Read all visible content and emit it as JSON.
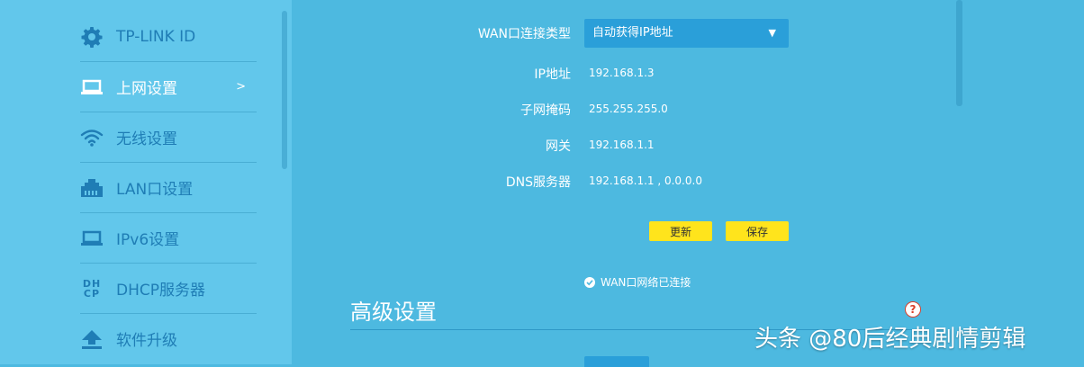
{
  "sidebar": {
    "items": [
      {
        "label": "TP-LINK ID",
        "icon": "gear-icon",
        "active": false
      },
      {
        "label": "上网设置",
        "icon": "laptop-icon",
        "active": true,
        "arrow": ">"
      },
      {
        "label": "无线设置",
        "icon": "wifi-icon",
        "active": false
      },
      {
        "label": "LAN口设置",
        "icon": "ethernet-port-icon",
        "active": false
      },
      {
        "label": "IPv6设置",
        "icon": "laptop-icon",
        "active": false
      },
      {
        "label": "DHCP服务器",
        "icon": "dhcp-icon",
        "icon_text": [
          "DH",
          "CP"
        ],
        "active": false
      },
      {
        "label": "软件升级",
        "icon": "upload-icon",
        "active": false
      }
    ]
  },
  "wan": {
    "type_label": "WAN口连接类型",
    "type_value": "自动获得IP地址",
    "fields": [
      {
        "label": "IP地址",
        "value": "192.168.1.3"
      },
      {
        "label": "子网掩码",
        "value": "255.255.255.0"
      },
      {
        "label": "网关",
        "value": "192.168.1.1"
      },
      {
        "label": "DNS服务器",
        "value": "192.168.1.1 , 0.0.0.0"
      }
    ],
    "refresh_label": "更新",
    "save_label": "保存",
    "status_text": "WAN口网络已连接"
  },
  "advanced": {
    "title": "高级设置",
    "help_symbol": "?"
  },
  "watermark": "头条 @80后经典剧情剪辑",
  "colors": {
    "background": "#4db9e0",
    "sidebar": "#62c7eb",
    "nav_text": "#1f7db5",
    "select_bg": "#2a9fd9",
    "button_yellow": "#ffe41c",
    "help_red": "#d9402b"
  }
}
